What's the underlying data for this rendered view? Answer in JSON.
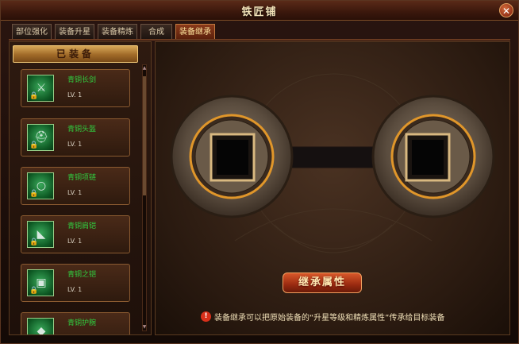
{
  "window": {
    "title": "铁匠铺",
    "close_label": "✕"
  },
  "tabs": [
    {
      "label": "部位强化",
      "active": false
    },
    {
      "label": "装备升星",
      "active": false
    },
    {
      "label": "装备精炼",
      "active": false
    },
    {
      "label": "合成",
      "active": false
    },
    {
      "label": "装备继承",
      "active": true
    }
  ],
  "sidebar": {
    "header": "已装备",
    "items": [
      {
        "name": "青铜长剑",
        "level": "LV. 1",
        "icon": "sword-icon"
      },
      {
        "name": "青铜头盔",
        "level": "LV. 1",
        "icon": "helmet-icon"
      },
      {
        "name": "青铜项链",
        "level": "LV. 1",
        "icon": "necklace-icon"
      },
      {
        "name": "青铜肩铠",
        "level": "LV. 1",
        "icon": "shoulder-armor-icon"
      },
      {
        "name": "青铜之铠",
        "level": "LV. 1",
        "icon": "chest-armor-icon"
      },
      {
        "name": "青铜护腕",
        "level": "",
        "icon": "bracer-icon"
      }
    ]
  },
  "main": {
    "inherit_button": "继承属性",
    "info_text": "装备继承可以把原始装备的“升星等级和精炼属性”传承给目标装备",
    "info_icon": "exclamation-icon"
  },
  "colors": {
    "accent": "#c07a40",
    "item_name": "#30d040",
    "title_text": "#f3e2b8"
  }
}
